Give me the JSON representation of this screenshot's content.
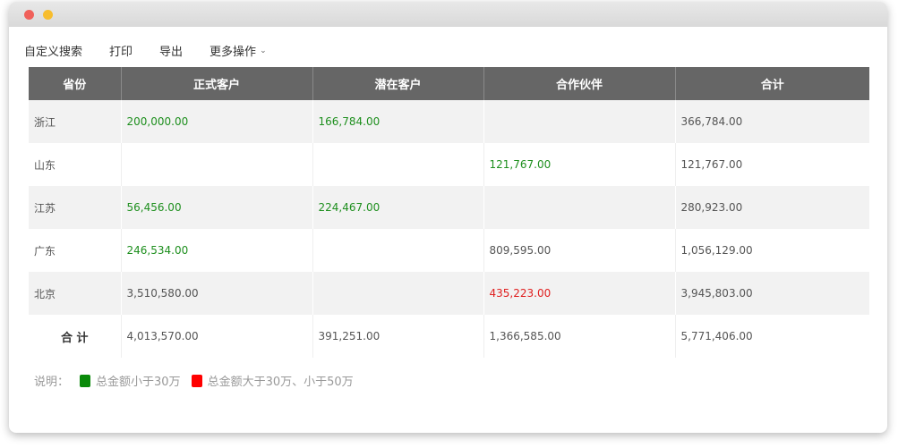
{
  "window": {
    "controls": [
      "close",
      "minimize"
    ]
  },
  "toolbar": {
    "custom_search": "自定义搜索",
    "print": "打印",
    "export": "导出",
    "more_actions": "更多操作"
  },
  "table": {
    "headers": [
      "省份",
      "正式客户",
      "潜在客户",
      "合作伙伴",
      "合计"
    ],
    "rows": [
      {
        "province": "浙江",
        "formal": "200,000.00",
        "potential": "166,784.00",
        "partner": "",
        "total": "366,784.00"
      },
      {
        "province": "山东",
        "formal": "",
        "potential": "",
        "partner": "121,767.00",
        "total": "121,767.00"
      },
      {
        "province": "江苏",
        "formal": "56,456.00",
        "potential": "224,467.00",
        "partner": "",
        "total": "280,923.00"
      },
      {
        "province": "广东",
        "formal": "246,534.00",
        "potential": "",
        "partner": "809,595.00",
        "total": "1,056,129.00"
      },
      {
        "province": "北京",
        "formal": "3,510,580.00",
        "potential": "",
        "partner": "435,223.00",
        "total": "3,945,803.00"
      }
    ],
    "totals": {
      "label": "合 计",
      "formal": "4,013,570.00",
      "potential": "391,251.00",
      "partner": "1,366,585.00",
      "total": "5,771,406.00"
    }
  },
  "legend": {
    "label": "说明：",
    "green_text": "总金额小于30万",
    "red_text": "总金额大于30万、小于50万"
  },
  "colors": {
    "green": "#1e8f1e",
    "red": "#e02020",
    "header_bg": "#666666",
    "stripe_bg": "#f2f2f2"
  }
}
